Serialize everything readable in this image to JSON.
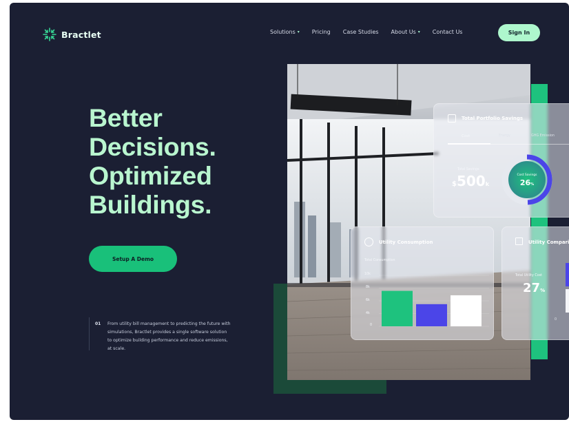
{
  "brand": {
    "name": "Bractlet"
  },
  "nav": {
    "items": [
      {
        "label": "Solutions",
        "dropdown": true
      },
      {
        "label": "Pricing",
        "dropdown": false
      },
      {
        "label": "Case Studies",
        "dropdown": false
      },
      {
        "label": "About Us",
        "dropdown": true
      },
      {
        "label": "Contact Us",
        "dropdown": false
      }
    ],
    "sign_in": "Sign In"
  },
  "hero": {
    "lines": [
      "Better",
      "Decisions.",
      "Optimized",
      "Buildings."
    ],
    "cta": "Setup A Demo"
  },
  "description": {
    "number": "01",
    "text": "From utility bill management to predicting the future with simulations, Bractlet provides a single software solution to optimize building performance and reduce emissions, at scale."
  },
  "savings_card": {
    "title": "Total Portfolio Savings",
    "tabs": [
      "Cost",
      "Energy",
      "GHG Emission"
    ],
    "total_label": "Total Savings",
    "currency": "$",
    "amount": "500",
    "suffix": "k",
    "donut_label": "Cost Savings",
    "donut_value": "26",
    "donut_unit": "%",
    "donut_fraction": 0.26
  },
  "consumption_card": {
    "title": "Utility Consumption",
    "subtitle": "Total Consumption",
    "y_ticks": [
      "10k",
      "8k",
      "6k",
      "4k",
      "0"
    ],
    "bars": [
      {
        "value": 4.8,
        "color": "#1ec27e"
      },
      {
        "value": 3.0,
        "color": "#4b45e8"
      },
      {
        "value": 4.2,
        "color": "#ffffff"
      }
    ],
    "y_max": 10
  },
  "comparison_card": {
    "title": "Utility Comparis",
    "label": "Total Utility Cost",
    "value": "27",
    "unit": "%",
    "axis_zero": "0"
  },
  "colors": {
    "background": "#1b1f33",
    "accent": "#1ec27e",
    "hero_text": "#b9f6cf",
    "deep_green": "#1b4a39",
    "purple": "#4b45e8"
  }
}
